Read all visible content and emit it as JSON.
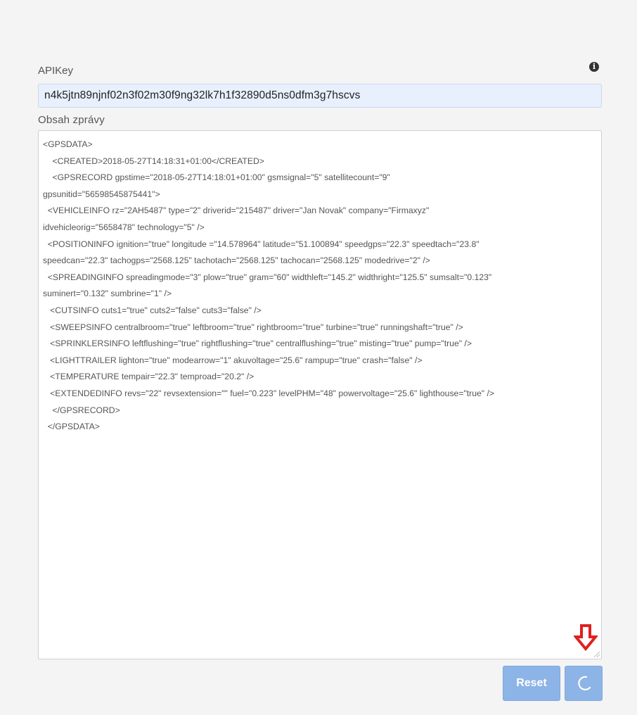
{
  "form": {
    "apikey_label": "APIKey",
    "apikey_value": "n4k5jtn89njnf02n3f02m30f9ng32lk7h1f32890d5ns0dfm3g7hscvs",
    "message_label": "Obsah zprávy",
    "info_icon": "i"
  },
  "message": {
    "lines": [
      "<GPSDATA>",
      "    <CREATED>2018-05-27T14:18:31+01:00</CREATED>",
      "    <GPSRECORD gpstime=\"2018-05-27T14:18:01+01:00\" gsmsignal=\"5\" satellitecount=\"9\"",
      "gpsunitid=\"56598545875441\">",
      "  <VEHICLEINFO rz=\"2AH5487\" type=\"2\" driverid=\"215487\" driver=\"Jan Novak\" company=\"Firmaxyz\"",
      "idvehicleorig=\"5658478\" technology=\"5\" />",
      "  <POSITIONINFO ignition=\"true\" longitude =\"14.578964\" latitude=\"51.100894\" speedgps=\"22.3\" speedtach=\"23.8\"",
      "speedcan=\"22.3\" tachogps=\"2568.125\" tachotach=\"2568.125\" tachocan=\"2568.125\" modedrive=\"2\" />",
      "  <SPREADINGINFO spreadingmode=\"3\" plow=\"true\" gram=\"60\" widthleft=\"145.2\" widthright=\"125.5\" sumsalt=\"0.123\"",
      "suminert=\"0.132\" sumbrine=\"1\" />",
      "   <CUTSINFO cuts1=\"true\" cuts2=\"false\" cuts3=\"false\" />",
      "   <SWEEPSINFO centralbroom=\"true\" leftbroom=\"true\" rightbroom=\"true\" turbine=\"true\" runningshaft=\"true\" />",
      "   <SPRINKLERSINFO leftflushing=\"true\" rightflushing=\"true\" centralflushing=\"true\" misting=\"true\" pump=\"true\" />",
      "   <LIGHTTRAILER lighton=\"true\" modearrow=\"1\" akuvoltage=\"25.6\" rampup=\"true\" crash=\"false\" />",
      "   <TEMPERATURE tempair=\"22.3\" temproad=\"20.2\" />",
      "   <EXTENDEDINFO revs=\"22\" revsextension=\"\" fuel=\"0.223\" levelPHM=\"48\" powervoltage=\"25.6\" lighthouse=\"true\" />",
      "    </GPSRECORD>",
      "  </GPSDATA>"
    ]
  },
  "buttons": {
    "reset_label": "Reset",
    "submit_icon": "spinner-icon"
  },
  "colors": {
    "button_bg": "#8db4e6",
    "input_autofill_bg": "#e8f0fe",
    "arrow": "#e02020"
  }
}
